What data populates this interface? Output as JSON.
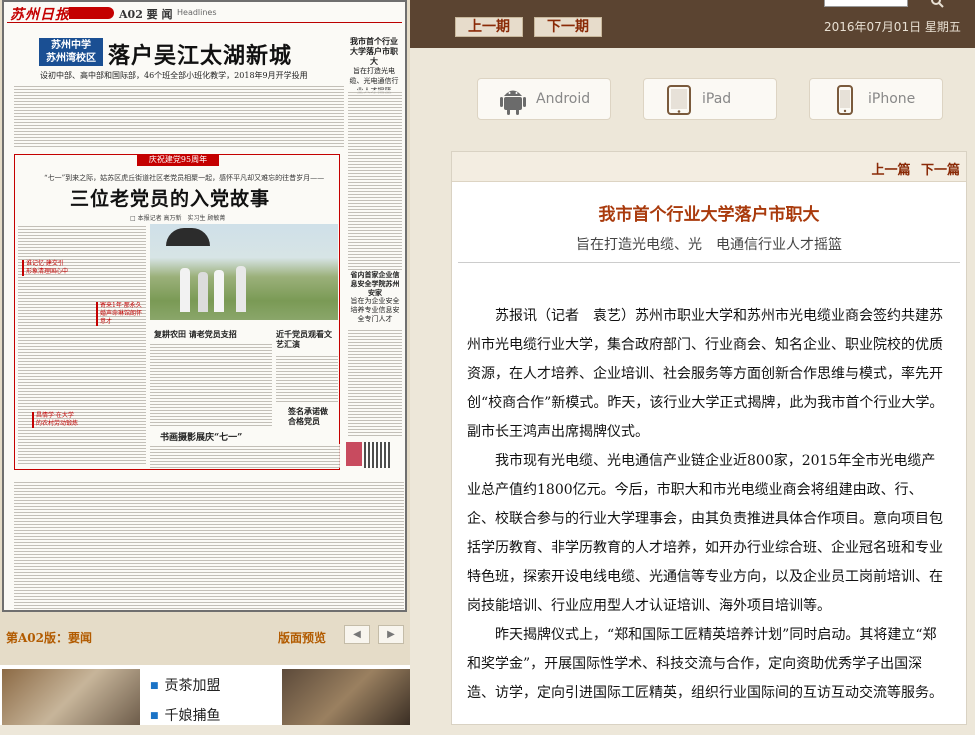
{
  "newspaper": {
    "masthead": "苏州日报",
    "section": "A02 要 闻",
    "section_en": "Headlines",
    "tag": "苏州中学\n苏州湾校区",
    "headline": "落户吴江太湖新城",
    "subhead": "设初中部、高中部和国际部，46个班全部小班化教学，2018年9月开学投用",
    "side_title": "我市首个行业大学落户市职大",
    "side_sub": "旨在打造光电缆、光电通信行业人才摇篮",
    "red_banner": "庆祝建党95周年",
    "kicker": "“七一”到来之际，姑苏区虎丘街道社区老党员相聚一起，感怀平凡却又难忘的往昔岁月——",
    "headline2": "三位老党员的入党故事",
    "byline": "□ 本报记者 高万新　实习生 顾敏菁",
    "callout1": "谁记忆·建交引 形象清理国心中",
    "callout2": "寄来1年·那永久 婚声命琳馆朗怀意才",
    "callout3": "昌情学·在大学 的农村劳动锻炼",
    "sub_head1": "复耕农田 请老党员支招",
    "sub_head2": "近千党员观看文艺汇演",
    "sub_head3": "书画摄影展庆“七一”",
    "sub_head4": "签名承诺做合格党员",
    "right_ad": "省内首家企业信息安全学院苏州安家",
    "right_ad_sub": "旨在为企业安全培养专业信息安全专门人才"
  },
  "left_footer": {
    "edition": "第A02版：要闻",
    "preview": "版面预览",
    "prev_arrow": "◀",
    "next_arrow": "▶"
  },
  "news_list": [
    "贡茶加盟",
    "千娘捕鱼"
  ],
  "top_bar": {
    "prev_issue": "上一期",
    "next_issue": "下一期",
    "date": "2016年07月01日 星期五"
  },
  "apps": [
    {
      "label": "Android",
      "icon": "android-icon"
    },
    {
      "label": "iPad",
      "icon": "ipad-icon"
    },
    {
      "label": "iPhone",
      "icon": "iphone-icon"
    }
  ],
  "article": {
    "prev_link": "上一篇",
    "next_link": "下一篇",
    "title": "我市首个行业大学落户市职大",
    "subtitle": "旨在打造光电缆、光　电通信行业人才摇篮",
    "paragraphs": [
      "苏报讯（记者　袁艺）苏州市职业大学和苏州市光电缆业商会签约共建苏州市光电缆行业大学，集合政府部门、行业商会、知名企业、职业院校的优质资源，在人才培养、企业培训、社会服务等方面创新合作思维与模式，率先开创“校商合作”新模式。昨天，该行业大学正式揭牌，此为我市首个行业大学。副市长王鸿声出席揭牌仪式。",
      "我市现有光电缆、光电通信产业链企业近800家，2015年全市光电缆产业总产值约1800亿元。今后，市职大和市光电缆业商会将组建由政、行、企、校联合参与的行业大学理事会，由其负责推进具体合作项目。意向项目包括学历教育、非学历教育的人才培养，如开办行业综合班、企业冠名班和专业特色班，探索开设电线电缆、光通信等专业方向，以及企业员工岗前培训、在岗技能培训、行业应用型人才认证培训、海外项目培训等。",
      "昨天揭牌仪式上，“郑和国际工匠精英培养计划”同时启动。其将建立“郑和奖学金”，开展国际性学术、科技交流与合作，定向资助优秀学子出国深造、访学，定向引进国际工匠精英，组织行业国际间的互访互动交流等服务。"
    ]
  },
  "colors": {
    "top_bar_bg": "#5b4431",
    "accent_red": "#c40000",
    "title_color": "#a93a0c",
    "link_color": "#8a2a07"
  }
}
